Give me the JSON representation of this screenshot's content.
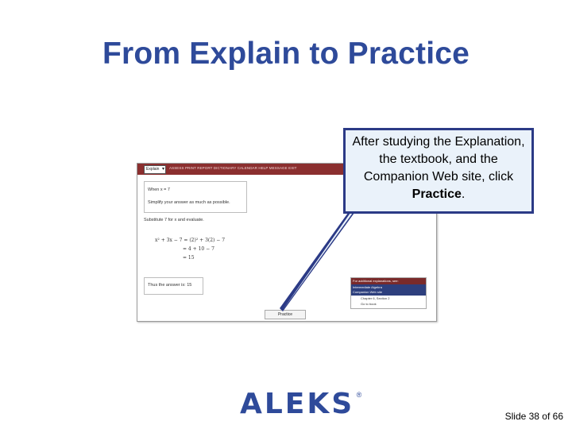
{
  "slide": {
    "title": "From Explain to Practice",
    "slide_number": "Slide 38 of 66"
  },
  "callout": {
    "text_before": "After studying the Explanation, the textbook, and the Companion Web site, click ",
    "bold_word": "Practice",
    "text_after": "."
  },
  "screenshot": {
    "topbar": {
      "select_value": "Explain",
      "menu_text": "ASSESS   PRINT   REPORT   DICTIONARY   CALENDAR   HELP   MESSAGE   EXIT"
    },
    "problem": {
      "line1": "When x = 7",
      "line2": "Simplify your answer as much as possible."
    },
    "substitute": "Substitute  7  for  x  and evaluate.",
    "equations": [
      "x² + 3x − 7  =  (2)² + 3(2) − 7",
      "=  4 + 10 − 7",
      "=  15"
    ],
    "answer": "Thus the answer is:  15",
    "practice_button": "Practice",
    "resources_panel": {
      "header": "For additional explanations, see:",
      "title_line1": "Intermediate Algebra",
      "title_line2": "Companion Web site",
      "items": [
        "Chapter 6, Section 2",
        "Go to book"
      ]
    }
  },
  "logo": {
    "word": "ALEKS",
    "registered": "®"
  },
  "colors": {
    "title": "#2e4a9a",
    "callout_border": "#2b3a86",
    "callout_fill": "#eaf2fa",
    "topbar": "#8b2f2f"
  }
}
